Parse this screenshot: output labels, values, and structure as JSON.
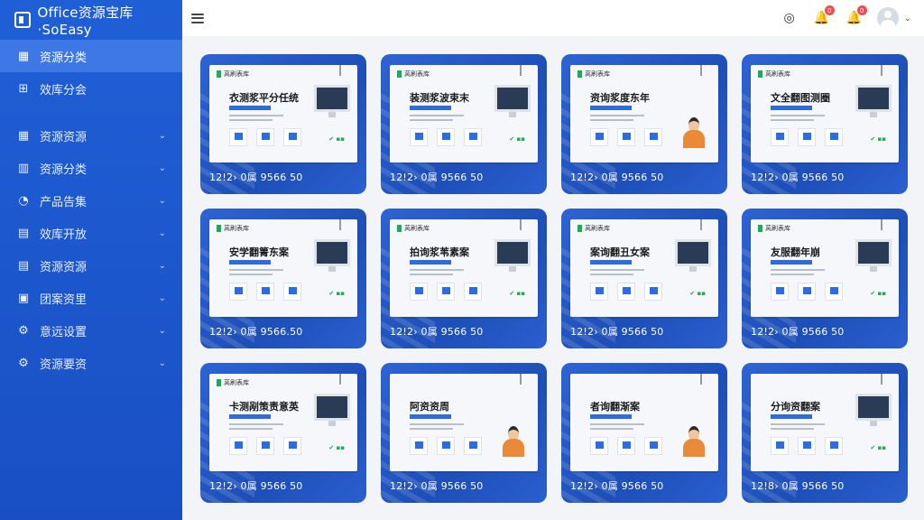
{
  "app": {
    "title": "Office资源宝库·SoEasy"
  },
  "sidebar": {
    "items": [
      {
        "label": "资源分类",
        "icon": "grid-icon",
        "glyph": "▦",
        "active": true,
        "chevron": false
      },
      {
        "label": "效库分会",
        "icon": "apps-icon",
        "glyph": "⊞",
        "active": false,
        "chevron": false
      },
      {
        "label": "资源资源",
        "icon": "grid-icon",
        "glyph": "▦",
        "active": false,
        "chevron": true
      },
      {
        "label": "资源分类",
        "icon": "chart-icon",
        "glyph": "▥",
        "active": false,
        "chevron": true
      },
      {
        "label": "产品告集",
        "icon": "clock-icon",
        "glyph": "◔",
        "active": false,
        "chevron": true
      },
      {
        "label": "效库开放",
        "icon": "folder-icon",
        "glyph": "▤",
        "active": false,
        "chevron": true
      },
      {
        "label": "资源资源",
        "icon": "document-icon",
        "glyph": "▤",
        "active": false,
        "chevron": true
      },
      {
        "label": "团案资里",
        "icon": "image-icon",
        "glyph": "▣",
        "active": false,
        "chevron": true
      },
      {
        "label": "意远设置",
        "icon": "gear-icon",
        "glyph": "⚙",
        "active": false,
        "chevron": true
      },
      {
        "label": "资源要资",
        "icon": "gear-icon",
        "glyph": "⚙",
        "active": false,
        "chevron": true
      }
    ]
  },
  "topbar": {
    "menu_icon": "hamburger-icon",
    "icons": [
      {
        "name": "settings-icon",
        "glyph": "◎",
        "badge": ""
      },
      {
        "name": "bell-icon",
        "glyph": "🔔",
        "badge": "0"
      },
      {
        "name": "notification-icon",
        "glyph": "🔔",
        "badge": "0"
      }
    ]
  },
  "cards": [
    {
      "tag": "莴刷表库",
      "title": "衣测浆平分任统",
      "meta": "12!2› 0属 9566 50",
      "variant": "monitor"
    },
    {
      "tag": "莴刷表库",
      "title": "装测浆波束末",
      "meta": "12!2› 0属 9566 50",
      "variant": "monitor"
    },
    {
      "tag": "莴刷表库",
      "title": "资询浆度东年",
      "meta": "12!2› 0属 9566 50",
      "variant": "person"
    },
    {
      "tag": "莴刷表库",
      "title": "文全翻图测圈",
      "meta": "12!2› 0属 9566 50",
      "variant": "monitor"
    },
    {
      "tag": "莴刷表库",
      "title": "安学翻箐东案",
      "meta": "12!2› 0属 9566.50",
      "variant": "monitor"
    },
    {
      "tag": "莴刷表库",
      "title": "拍询浆苇素案",
      "meta": "12!2› 0属 9566 50",
      "variant": "monitor"
    },
    {
      "tag": "莴刷表库",
      "title": "案询翻丑女案",
      "meta": "12!2› 0属 9566 50",
      "variant": "monitor"
    },
    {
      "tag": "莴刷表库",
      "title": "友服翻年崩",
      "meta": "12!2› 0属 9566 50",
      "variant": "monitor"
    },
    {
      "tag": "莴刷表库",
      "title": "卡测剐策责意英",
      "meta": "12!2› 0属 9566 50",
      "variant": "monitor"
    },
    {
      "tag": "",
      "title": "阿资资周",
      "meta": "12!2› 0属 9566 50",
      "variant": "person"
    },
    {
      "tag": "",
      "title": "者询翻渐案",
      "meta": "12!2› 0属 9566 50",
      "variant": "person"
    },
    {
      "tag": "",
      "title": "分询资翻案",
      "meta": "12!8› 0属 9566 50",
      "variant": "monitor"
    }
  ]
}
